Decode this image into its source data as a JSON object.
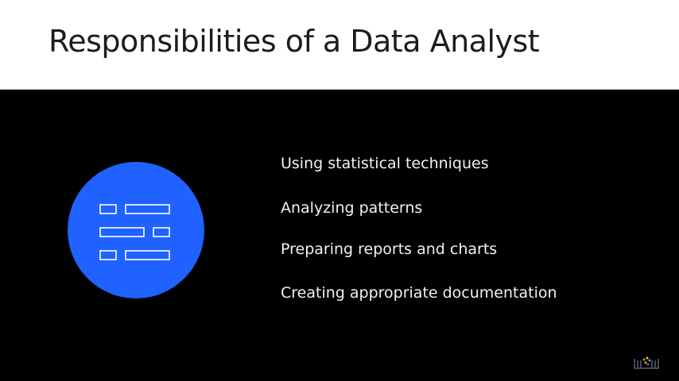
{
  "slide": {
    "title": "Responsibilities of a Data Analyst",
    "items": [
      "Using statistical techniques",
      "Analyzing patterns",
      "Preparing reports and charts",
      "Creating appropriate documentation"
    ]
  },
  "icon": {
    "name": "document-list-icon",
    "circle_color": "#1f62ff"
  },
  "watermark": {
    "name": "library-logo-icon"
  }
}
